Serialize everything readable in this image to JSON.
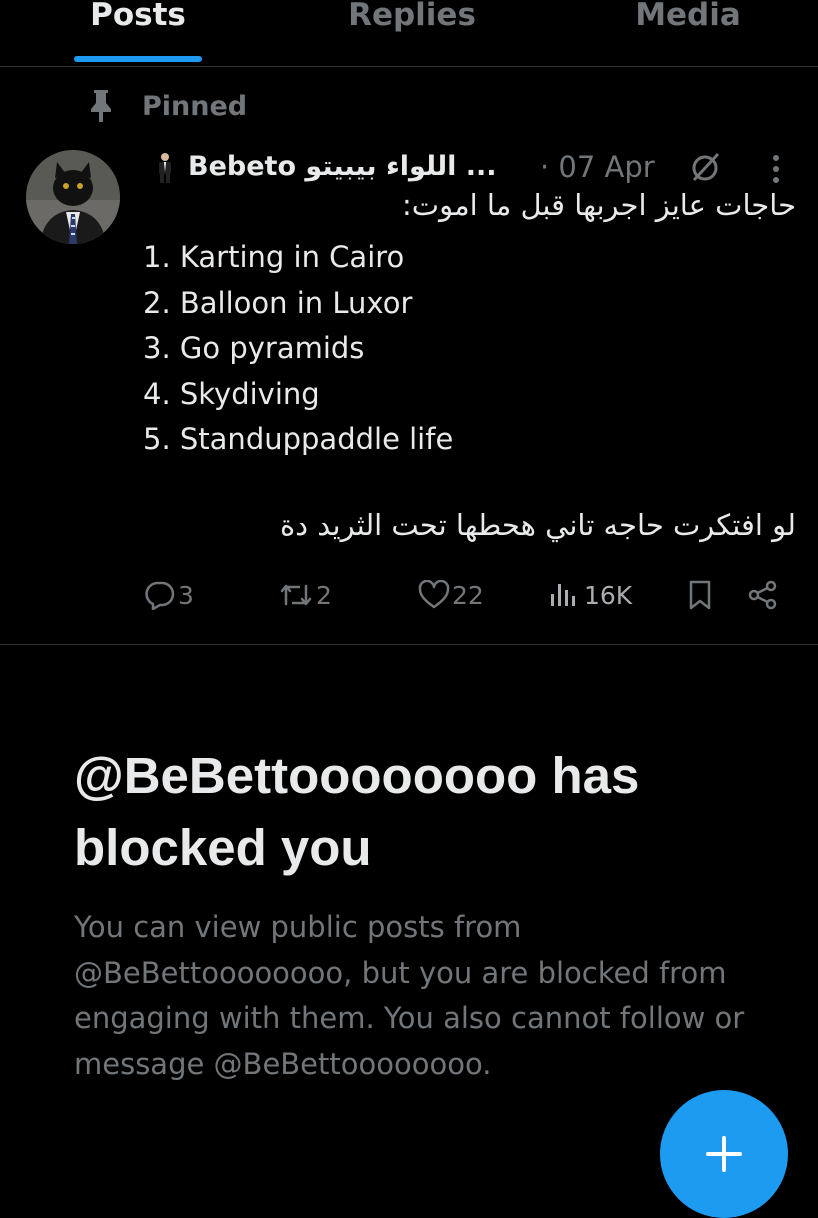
{
  "tabs": [
    {
      "label": "Posts",
      "active": true
    },
    {
      "label": "Replies",
      "active": false
    },
    {
      "label": "Media",
      "active": false
    }
  ],
  "accent_color": "#1d9bf0",
  "pinned": {
    "label": "Pinned",
    "icon": "pin-icon"
  },
  "post": {
    "author_display": "Bebeto اللواء بيبيتو ...",
    "date": "· 07 Apr",
    "line1": "حاجات عايز اجربها قبل ما اموت:",
    "items": [
      "1. Karting in Cairo",
      "2. Balloon in Luxor",
      "3. Go pyramids",
      "4. Skydiving",
      "5. Standuppaddle life"
    ],
    "line2": "لو افتكرت حاجه تاني هحطها تحت الثريد دة",
    "stats": {
      "replies": "3",
      "reposts": "2",
      "likes": "22",
      "views": "16K"
    }
  },
  "blocked": {
    "title": "@BeBettoooooooo has blocked you",
    "description": "You can view public posts from @BeBettoooooooo, but you are blocked from engaging with them. You also cannot follow or message @BeBettoooooooo."
  },
  "fab": {
    "icon": "plus-icon"
  }
}
